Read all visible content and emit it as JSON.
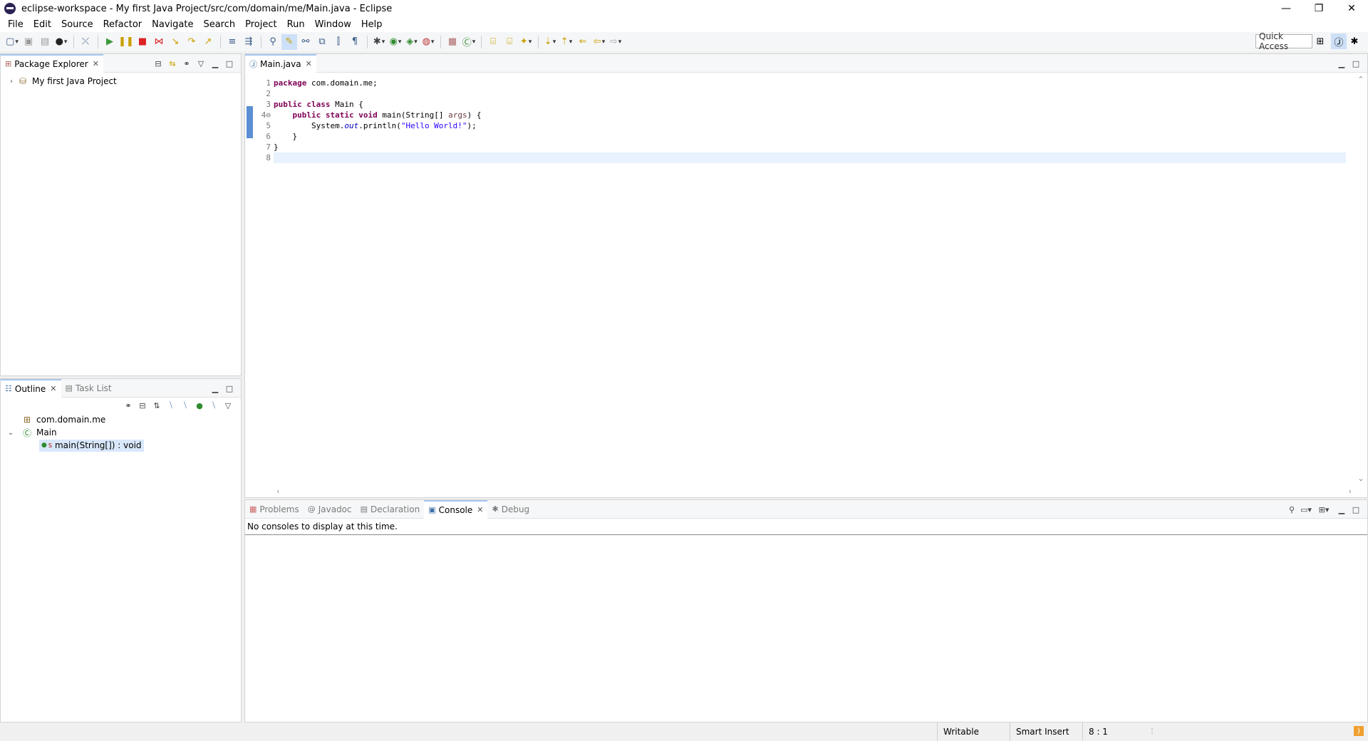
{
  "window": {
    "title": "eclipse-workspace - My first Java Project/src/com/domain/me/Main.java - Eclipse",
    "minimize": "—",
    "restore": "❐",
    "close": "✕"
  },
  "menu": [
    "File",
    "Edit",
    "Source",
    "Refactor",
    "Navigate",
    "Search",
    "Project",
    "Run",
    "Window",
    "Help"
  ],
  "toolbar": {
    "quick_access": "Quick Access"
  },
  "package_explorer": {
    "tab_label": "Package Explorer",
    "project": "My first Java Project"
  },
  "outline": {
    "tab_label": "Outline",
    "task_list_label": "Task List",
    "package": "com.domain.me",
    "class": "Main",
    "method": "main(String[]) : void",
    "method_modifier": "S"
  },
  "editor": {
    "tab_label": "Main.java",
    "line_numbers": [
      "1",
      "2",
      "3",
      "4⊖",
      "5",
      "6",
      "7",
      "8"
    ]
  },
  "console": {
    "tabs": {
      "problems": "Problems",
      "javadoc": "Javadoc",
      "declaration": "Declaration",
      "console": "Console",
      "debug": "Debug"
    },
    "message": "No consoles to display at this time."
  },
  "status": {
    "writable": "Writable",
    "insert_mode": "Smart Insert",
    "position": "8 : 1"
  },
  "colors": {
    "keyword": "#7f0055",
    "string": "#2a00ff",
    "field": "#0000c0",
    "selection": "#d9e8fb"
  }
}
